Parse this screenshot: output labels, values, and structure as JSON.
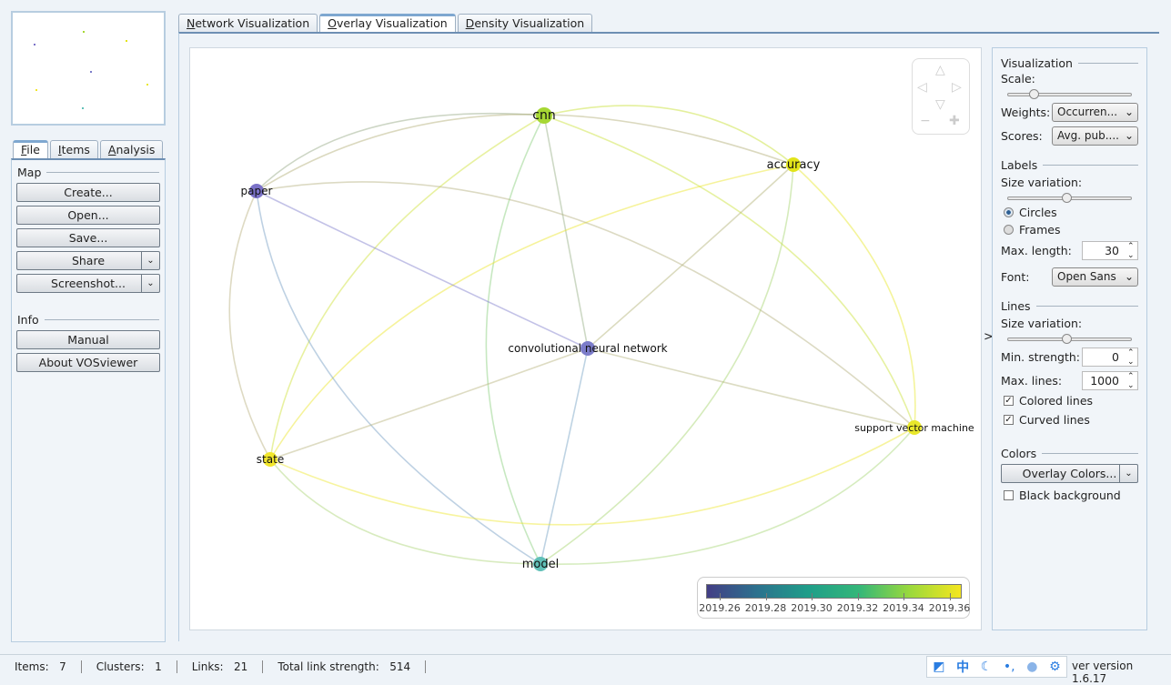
{
  "main_tabs": [
    {
      "label": "Network Visualization",
      "key": "N",
      "rest": "etwork Visualization"
    },
    {
      "label": "Overlay Visualization",
      "key": "O",
      "rest": "verlay Visualization",
      "active": true
    },
    {
      "label": "Density Visualization",
      "key": "D",
      "rest": "ensity Visualization"
    }
  ],
  "left_tabs": [
    {
      "key": "F",
      "rest": "ile",
      "active": true
    },
    {
      "key": "I",
      "rest": "tems"
    },
    {
      "key": "A",
      "rest": "nalysis"
    }
  ],
  "file_panel": {
    "map_title": "Map",
    "create": "Create...",
    "open": "Open...",
    "save": "Save...",
    "share": "Share",
    "screenshot": "Screenshot...",
    "info_title": "Info",
    "manual": "Manual",
    "about": "About VOSviewer"
  },
  "network": {
    "nodes": [
      {
        "label": "cnn",
        "color": "#a6d733"
      },
      {
        "label": "accuracy",
        "color": "#e2e419"
      },
      {
        "label": "paper",
        "color": "#7b72c8"
      },
      {
        "label": "convolutional neural network",
        "color": "#7b7cc9"
      },
      {
        "label": "support vector machine",
        "color": "#e9e82b"
      },
      {
        "label": "state",
        "color": "#f1e62b"
      },
      {
        "label": "model",
        "color": "#60c0b7"
      }
    ],
    "link_count_note_hidden": null
  },
  "legend": {
    "ticks": [
      "2019.26",
      "2019.28",
      "2019.30",
      "2019.32",
      "2019.34",
      "2019.36"
    ],
    "colors": [
      "#433e85",
      "#2c728e",
      "#1f9e89",
      "#35b779",
      "#9bd93c",
      "#f5e61f"
    ]
  },
  "right_panel": {
    "visualization_title": "Visualization",
    "scale_label": "Scale:",
    "scale_value": 0.22,
    "weights_label": "Weights:",
    "weights_value": "Occurren...",
    "scores_label": "Scores:",
    "scores_value": "Avg. pub....",
    "labels_title": "Labels",
    "size_variation_label": "Size variation:",
    "label_size_variation": 0.5,
    "circles": "Circles",
    "frames": "Frames",
    "max_length_label": "Max. length:",
    "max_length": "30",
    "font_label": "Font:",
    "font_value": "Open Sans",
    "lines_title": "Lines",
    "line_size_label": "Size variation:",
    "line_size_variation": 0.5,
    "min_strength_label": "Min. strength:",
    "min_strength": "0",
    "max_lines_label": "Max. lines:",
    "max_lines": "1000",
    "colored_lines": "Colored lines",
    "curved_lines": "Curved lines",
    "colors_title": "Colors",
    "overlay_colors": "Overlay Colors...",
    "black_background": "Black background"
  },
  "status": {
    "items_label": "Items:",
    "items": "7",
    "clusters_label": "Clusters:",
    "clusters": "1",
    "links_label": "Links:",
    "links": "21",
    "tls_label": "Total link strength:",
    "tls": "514",
    "version": "ver version 1.6.17"
  },
  "tray_icons": [
    "edit-icon",
    "chinese-input-icon",
    "moon-icon",
    "punctuation-icon",
    "user-icon",
    "gear-icon"
  ]
}
